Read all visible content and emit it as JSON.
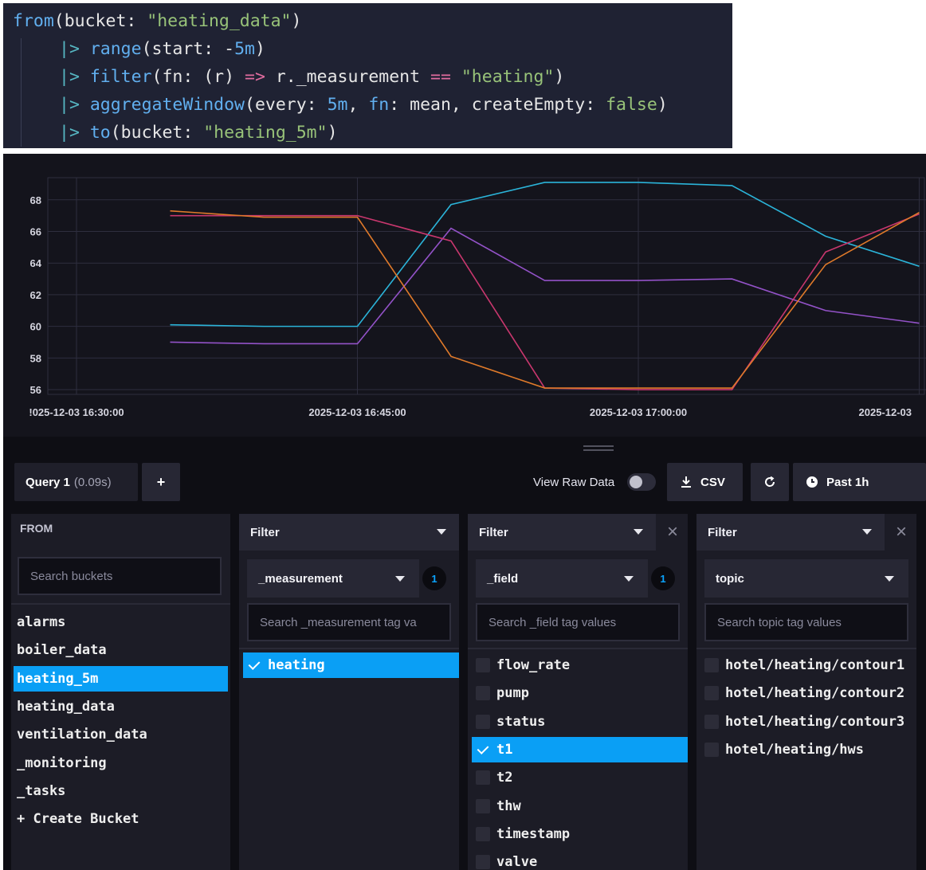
{
  "code": {
    "lines": [
      [
        [
          "fn",
          "from"
        ],
        [
          "",
          "(bucket: "
        ],
        [
          "str",
          "\"heating_data\""
        ],
        [
          "",
          ")"
        ]
      ],
      [
        [
          "pipe",
          "|> "
        ],
        [
          "fn",
          "range"
        ],
        [
          "",
          "(start: -"
        ],
        [
          "num",
          "5m"
        ],
        [
          "",
          ")"
        ]
      ],
      [
        [
          "pipe",
          "|> "
        ],
        [
          "fn",
          "filter"
        ],
        [
          "",
          "(fn: (r) "
        ],
        [
          "op",
          "=>"
        ],
        [
          "",
          " r._measurement "
        ],
        [
          "op",
          "=="
        ],
        [
          "",
          " "
        ],
        [
          "str",
          "\"heating\""
        ],
        [
          "",
          ")"
        ]
      ],
      [
        [
          "pipe",
          "|> "
        ],
        [
          "fn",
          "aggregateWindow"
        ],
        [
          "",
          "(every: "
        ],
        [
          "num",
          "5m"
        ],
        [
          "",
          ", "
        ],
        [
          "fn",
          "fn"
        ],
        [
          "",
          ": mean, createEmpty: "
        ],
        [
          "kw",
          "false"
        ],
        [
          "",
          ")"
        ]
      ],
      [
        [
          "pipe",
          "|> "
        ],
        [
          "fn",
          "to"
        ],
        [
          "",
          "(bucket: "
        ],
        [
          "str",
          "\"heating_5m\""
        ],
        [
          "",
          ")"
        ]
      ]
    ]
  },
  "chart_data": {
    "type": "line",
    "x": [
      "16:26",
      "16:35",
      "16:40",
      "16:45",
      "16:50",
      "16:55",
      "17:00",
      "17:05",
      "17:10",
      "17:15",
      "17:20"
    ],
    "x_tick_labels": [
      "2025-12-03 16:30:00",
      "2025-12-03 16:45:00",
      "2025-12-03 17:00:00",
      "2025-12-03"
    ],
    "x_tick_label_partial": [
      "!025-12-03 16:30:00",
      "2025-12-03 16:45:00",
      "2025-12-03 17:00:00",
      "2025-12-03"
    ],
    "y_ticks": [
      56,
      58,
      60,
      62,
      64,
      66,
      68
    ],
    "ylim": [
      55.7,
      69.4
    ],
    "grid": true,
    "series": [
      {
        "color": "#2bb4d9",
        "values": [
          null,
          60.1,
          60.0,
          60.0,
          67.7,
          69.1,
          69.1,
          68.9,
          65.7,
          63.8,
          null
        ]
      },
      {
        "color": "#9352c8",
        "values": [
          null,
          59.0,
          58.9,
          58.9,
          66.2,
          62.9,
          62.9,
          63.0,
          61.0,
          60.2,
          null
        ]
      },
      {
        "color": "#c9376e",
        "values": [
          null,
          67.0,
          67.0,
          67.0,
          65.4,
          56.1,
          56.0,
          56.0,
          64.7,
          67.1,
          null
        ]
      },
      {
        "color": "#e07a2a",
        "values": [
          null,
          67.3,
          66.9,
          66.9,
          58.1,
          56.1,
          56.1,
          56.1,
          63.9,
          67.2,
          null
        ]
      }
    ]
  },
  "toolbar": {
    "query_label": "Query 1",
    "query_time": "(0.09s)",
    "add_label": "+",
    "view_raw_label": "View Raw Data",
    "csv_label": "CSV",
    "time_label": "Past 1h"
  },
  "from": {
    "header": "FROM",
    "search_placeholder": "Search buckets",
    "buckets": [
      "alarms",
      "boiler_data",
      "heating_5m",
      "heating_data",
      "ventilation_data",
      "_monitoring",
      "_tasks",
      "+ Create Bucket"
    ],
    "selected": "heating_5m"
  },
  "filters": [
    {
      "header": "Filter",
      "key": "_measurement",
      "count": "1",
      "search_placeholder": "Search _measurement tag va",
      "values": [
        "heating"
      ],
      "selected": [
        "heating"
      ]
    },
    {
      "header": "Filter",
      "key": "_field",
      "count": "1",
      "search_placeholder": "Search _field tag values",
      "values": [
        "flow_rate",
        "pump",
        "status",
        "t1",
        "t2",
        "thw",
        "timestamp",
        "valve"
      ],
      "selected": [
        "t1"
      ]
    },
    {
      "header": "Filter",
      "key": "topic",
      "count": "",
      "search_placeholder": "Search topic tag values",
      "values": [
        "hotel/heating/contour1",
        "hotel/heating/contour2",
        "hotel/heating/contour3",
        "hotel/heating/hws"
      ],
      "selected": []
    }
  ],
  "colors": {
    "accent": "#0a9ff5",
    "bg": "#0e0e14",
    "card": "#1c1c26"
  }
}
